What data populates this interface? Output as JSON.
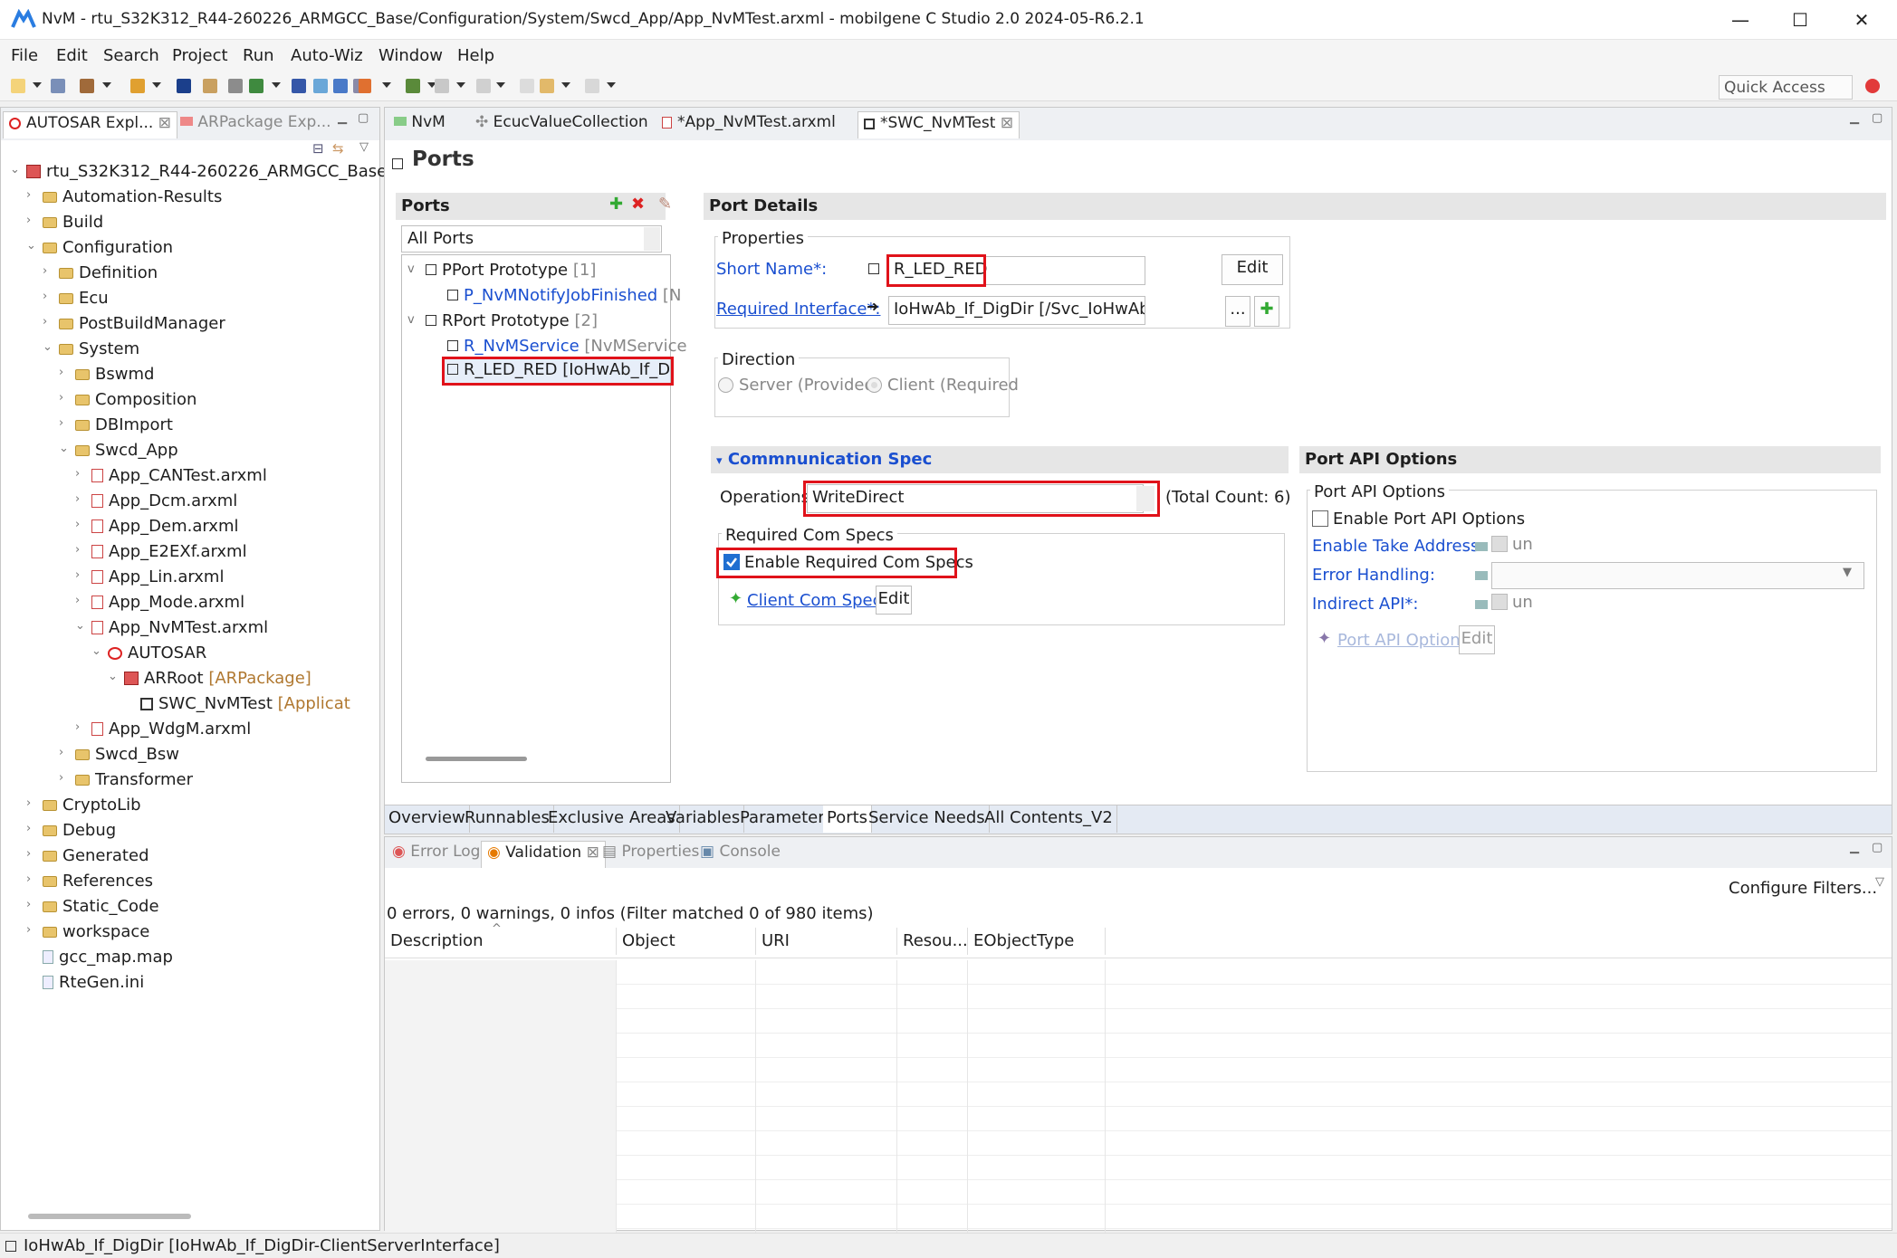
{
  "window": {
    "title": "NvM - rtu_S32K312_R44-260226_ARMGCC_Base/Configuration/System/Swcd_App/App_NvMTest.arxml - mobilgene C Studio 2.0 2024-05-R6.2.1",
    "minimize": "—",
    "maximize": "☐",
    "close": "✕"
  },
  "menu": [
    "File",
    "Edit",
    "Search",
    "Project",
    "Run",
    "Auto-Wiz",
    "Window",
    "Help"
  ],
  "quick_access": "Quick Access",
  "left_tabs": {
    "explorer": "AUTOSAR Expl...",
    "arpackage": "ARPackage Exp..."
  },
  "tree": [
    {
      "label": "rtu_S32K312_R44-260226_ARMGCC_Base",
      "suffix": "",
      "icon": "project",
      "depth": 0,
      "tw": "v"
    },
    {
      "label": "Automation-Results",
      "suffix": "",
      "icon": "folder",
      "depth": 1,
      "tw": ">"
    },
    {
      "label": "Build",
      "suffix": "",
      "icon": "folder",
      "depth": 1,
      "tw": ">"
    },
    {
      "label": "Configuration",
      "suffix": "",
      "icon": "folder",
      "depth": 1,
      "tw": "v"
    },
    {
      "label": "Definition",
      "suffix": "",
      "icon": "folder",
      "depth": 2,
      "tw": ">"
    },
    {
      "label": "Ecu",
      "suffix": "",
      "icon": "folder",
      "depth": 2,
      "tw": ">"
    },
    {
      "label": "PostBuildManager",
      "suffix": "",
      "icon": "folder",
      "depth": 2,
      "tw": ">"
    },
    {
      "label": "System",
      "suffix": "",
      "icon": "folder",
      "depth": 2,
      "tw": "v"
    },
    {
      "label": "Bswmd",
      "suffix": "",
      "icon": "folder",
      "depth": 3,
      "tw": ">"
    },
    {
      "label": "Composition",
      "suffix": "",
      "icon": "folder",
      "depth": 3,
      "tw": ">"
    },
    {
      "label": "DBImport",
      "suffix": "",
      "icon": "folder",
      "depth": 3,
      "tw": ">"
    },
    {
      "label": "Swcd_App",
      "suffix": "",
      "icon": "folder",
      "depth": 3,
      "tw": "v"
    },
    {
      "label": "App_CANTest.arxml",
      "suffix": "",
      "icon": "file",
      "depth": 4,
      "tw": ">"
    },
    {
      "label": "App_Dcm.arxml",
      "suffix": "",
      "icon": "file",
      "depth": 4,
      "tw": ">"
    },
    {
      "label": "App_Dem.arxml",
      "suffix": "",
      "icon": "file",
      "depth": 4,
      "tw": ">"
    },
    {
      "label": "App_E2EXf.arxml",
      "suffix": "",
      "icon": "file",
      "depth": 4,
      "tw": ">"
    },
    {
      "label": "App_Lin.arxml",
      "suffix": "",
      "icon": "file",
      "depth": 4,
      "tw": ">"
    },
    {
      "label": "App_Mode.arxml",
      "suffix": "",
      "icon": "file",
      "depth": 4,
      "tw": ">"
    },
    {
      "label": "App_NvMTest.arxml",
      "suffix": "",
      "icon": "file",
      "depth": 4,
      "tw": "v"
    },
    {
      "label": "AUTOSAR",
      "suffix": "",
      "icon": "red",
      "depth": 5,
      "tw": "v"
    },
    {
      "label": "ARRoot",
      "suffix": " [ARPackage]",
      "icon": "proj",
      "depth": 6,
      "tw": "v"
    },
    {
      "label": "SWC_NvMTest",
      "suffix": " [Applicat",
      "icon": "swc",
      "depth": 7,
      "tw": ""
    },
    {
      "label": "App_WdgM.arxml",
      "suffix": "",
      "icon": "file",
      "depth": 4,
      "tw": ">"
    },
    {
      "label": "Swcd_Bsw",
      "suffix": "",
      "icon": "folder",
      "depth": 3,
      "tw": ">"
    },
    {
      "label": "Transformer",
      "suffix": "",
      "icon": "folder",
      "depth": 3,
      "tw": ">"
    },
    {
      "label": "CryptoLib",
      "suffix": "",
      "icon": "folder",
      "depth": 1,
      "tw": ">"
    },
    {
      "label": "Debug",
      "suffix": "",
      "icon": "folder",
      "depth": 1,
      "tw": ">"
    },
    {
      "label": "Generated",
      "suffix": "",
      "icon": "folder",
      "depth": 1,
      "tw": ">"
    },
    {
      "label": "References",
      "suffix": "",
      "icon": "folder",
      "depth": 1,
      "tw": ">"
    },
    {
      "label": "Static_Code",
      "suffix": "",
      "icon": "folder",
      "depth": 1,
      "tw": ">"
    },
    {
      "label": "workspace",
      "suffix": "",
      "icon": "folder",
      "depth": 1,
      "tw": ">"
    },
    {
      "label": "gcc_map.map",
      "suffix": "",
      "icon": "plain",
      "depth": 1,
      "tw": ""
    },
    {
      "label": "RteGen.ini",
      "suffix": "",
      "icon": "plain",
      "depth": 1,
      "tw": ""
    }
  ],
  "editor_tabs": [
    "NvM",
    "EcucValueCollection",
    "*App_NvMTest.arxml",
    "*SWC_NvMTest"
  ],
  "page_title": "Ports",
  "ports": {
    "header": "Ports",
    "filter": "All Ports",
    "pport": {
      "label": "PPort Prototype",
      "count": "[1]"
    },
    "pport_items": [
      {
        "name": "P_NvMNotifyJobFinished",
        "type": " [N"
      }
    ],
    "rport": {
      "label": "RPort Prototype",
      "count": "[2]"
    },
    "rport_items": [
      {
        "name": "R_NvMService",
        "type": " [NvMService"
      },
      {
        "name": "R_LED_RED [IoHwAb_If_DigD",
        "type": ""
      }
    ]
  },
  "details": {
    "header": "Port Details",
    "properties": "Properties",
    "short_name_label": "Short Name*:",
    "short_name": "R_LED_RED",
    "edit": "Edit",
    "req_if_label": "Required Interface*:",
    "req_if": "IoHwAb_If_DigDir [/Svc_IoHwAb/ClientServe",
    "browse": "...",
    "direction": "Direction",
    "server": "Server (Provided",
    "client": "Client (Required"
  },
  "comm": {
    "header": "Commnunication Spec",
    "operations_label": "Operations",
    "operation": "WriteDirect",
    "total": "(Total Count: 6)",
    "req_specs": "Required Com Specs",
    "enable_req": "Enable Required Com Specs",
    "client_spec": "Client Com Spec",
    "edit": "Edit"
  },
  "api": {
    "header": "Port API Options",
    "group": "Port API Options",
    "enable": "Enable Port API Options",
    "take_addr": "Enable Take Address:",
    "err": "Error Handling:",
    "indirect": "Indirect API*:",
    "un": "un",
    "option": "Port API Option",
    "edit": "Edit"
  },
  "bottom_tabs": [
    "Overview",
    "Runnables",
    "Exclusive Areas",
    "Variables",
    "Parameters",
    "Ports",
    "Service Needs",
    "All Contents_V2"
  ],
  "views": {
    "error_log": "Error Log",
    "validation": "Validation",
    "properties": "Properties",
    "console": "Console",
    "configure": "Configure Filters...",
    "summary": "0 errors, 0 warnings, 0 infos (Filter matched 0 of 980 items)",
    "columns": [
      "Description",
      "Object",
      "URI",
      "Resou...",
      "EObjectType"
    ]
  },
  "status": "IoHwAb_If_DigDir [IoHwAb_If_DigDir-ClientServerInterface]",
  "colors": {
    "highlight": "#e0121a",
    "link": "#1a4fd0",
    "accent": "#1f6fd1"
  }
}
